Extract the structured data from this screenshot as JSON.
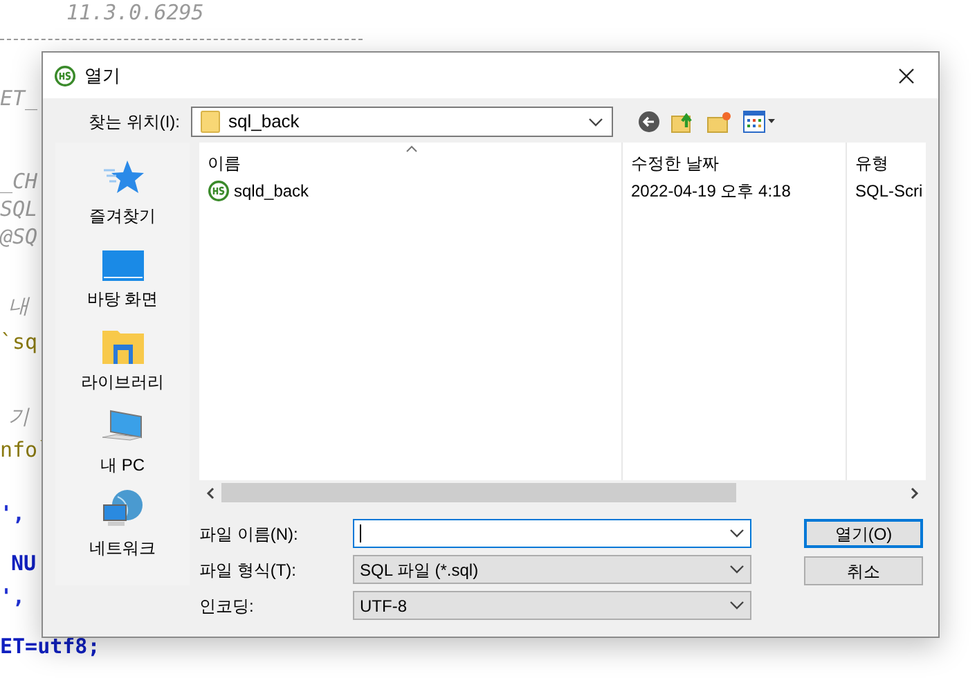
{
  "background_editor": {
    "lines": [
      {
        "text": "11.3.0.6295",
        "kind": "comment"
      },
      {
        "text": "ET_",
        "kind": "comment"
      },
      {
        "text": "_CH",
        "kind": "comment"
      },
      {
        "text": "SQL",
        "kind": "comment"
      },
      {
        "text": "@SQ",
        "kind": "comment"
      },
      {
        "text": "내",
        "kind": "comment"
      },
      {
        "text": "`sq",
        "kind": "name"
      },
      {
        "text": "기",
        "kind": "comment"
      },
      {
        "text": "nfo`",
        "kind": "name"
      },
      {
        "text": "',",
        "kind": "symbol"
      },
      {
        "text": "NU",
        "kind": "keyword"
      },
      {
        "text": "',",
        "kind": "symbol"
      },
      {
        "text": "ET=utf8;",
        "kind": "keyword"
      }
    ]
  },
  "dialog": {
    "title": "열기",
    "location": {
      "label": "찾는 위치(I):",
      "value": "sql_back"
    },
    "places": [
      {
        "label": "즐겨찾기",
        "kind": "star"
      },
      {
        "label": "바탕 화면",
        "kind": "desktop"
      },
      {
        "label": "라이브러리",
        "kind": "library"
      },
      {
        "label": "내 PC",
        "kind": "pc"
      },
      {
        "label": "네트워크",
        "kind": "network"
      }
    ],
    "file_list": {
      "columns": [
        "이름",
        "수정한 날짜",
        "유형"
      ],
      "rows": [
        {
          "name": "sqld_back",
          "modified": "2022-04-19 오후 4:18",
          "type": "SQL-Scri"
        }
      ]
    },
    "file_name": {
      "label": "파일 이름(N):"
    },
    "file_type": {
      "label": "파일 형식(T):",
      "value": "SQL 파일 (*.sql)"
    },
    "encoding": {
      "label": "인코딩:",
      "value": "UTF-8"
    },
    "buttons": [
      "열기(O)",
      "취소"
    ]
  }
}
